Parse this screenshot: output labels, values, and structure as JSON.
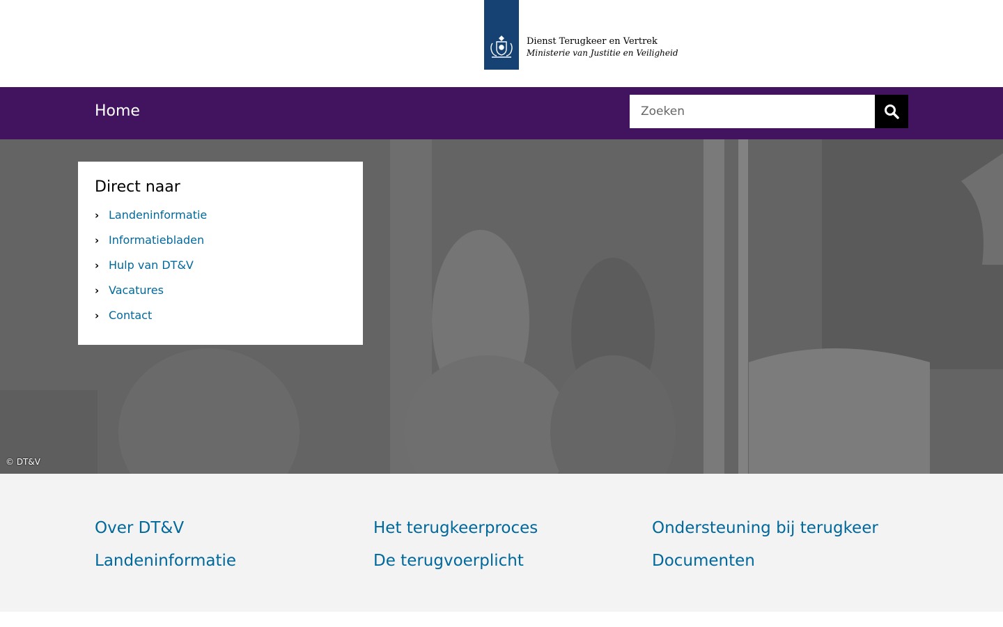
{
  "header": {
    "org_name": "Dienst Terugkeer en Vertrek",
    "ministry": "Ministerie van Justitie en Veiligheid"
  },
  "nav": {
    "home_label": "Home",
    "search_placeholder": "Zoeken"
  },
  "hero": {
    "credit": "© DT&V"
  },
  "direct": {
    "title": "Direct naar",
    "items": [
      {
        "label": "Landeninformatie"
      },
      {
        "label": "Informatiebladen"
      },
      {
        "label": "Hulp van DT&V"
      },
      {
        "label": "Vacatures"
      },
      {
        "label": "Contact"
      }
    ]
  },
  "links": [
    {
      "label": "Over DT&V"
    },
    {
      "label": "Het terugkeerproces"
    },
    {
      "label": "Ondersteuning bij terugkeer"
    },
    {
      "label": "Landeninformatie"
    },
    {
      "label": "De terugvoerplicht"
    },
    {
      "label": "Documenten"
    }
  ],
  "colors": {
    "brand_purple": "#42145f",
    "logo_blue": "#154273",
    "link_blue": "#01689b"
  }
}
